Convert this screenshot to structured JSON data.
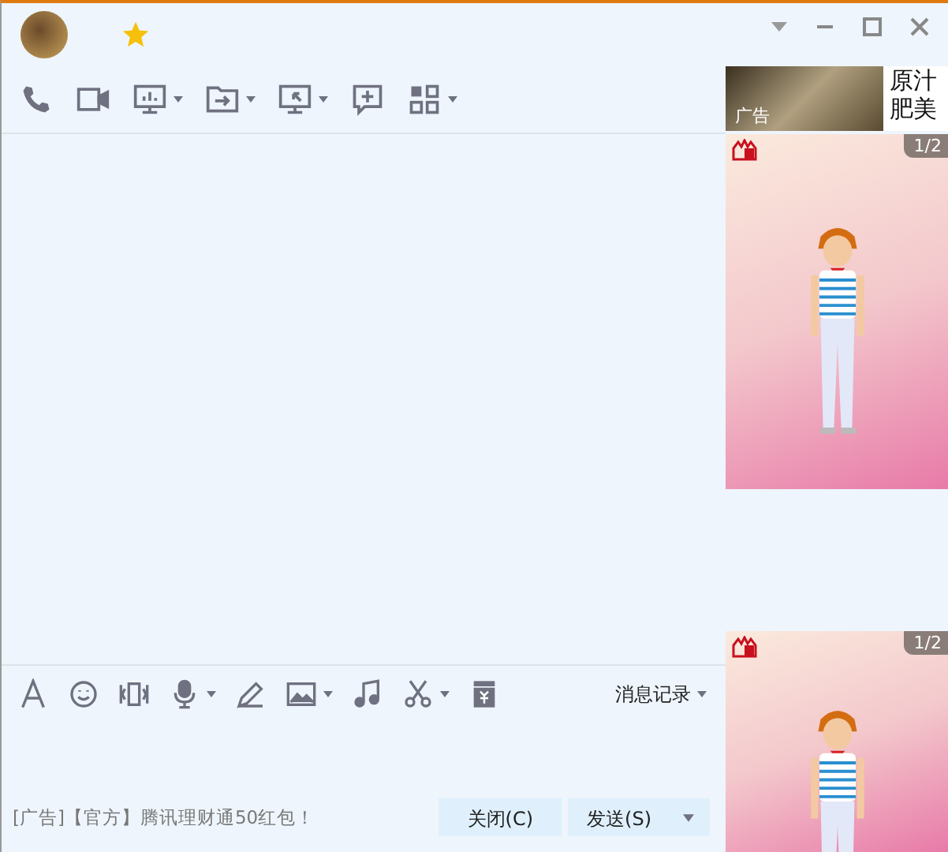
{
  "top_tools": [
    {
      "kind": "phone",
      "dropdown": false
    },
    {
      "kind": "video",
      "dropdown": false
    },
    {
      "kind": "screen-chart",
      "dropdown": true
    },
    {
      "kind": "folder-arrow",
      "dropdown": true
    },
    {
      "kind": "screen-arrow",
      "dropdown": true
    },
    {
      "kind": "chat-plus",
      "dropdown": false
    },
    {
      "kind": "apps",
      "dropdown": true
    }
  ],
  "input_tools": [
    {
      "kind": "font",
      "dropdown": false
    },
    {
      "kind": "smiley",
      "dropdown": false
    },
    {
      "kind": "shake",
      "dropdown": false
    },
    {
      "kind": "mic",
      "dropdown": true
    },
    {
      "kind": "pen",
      "dropdown": false
    },
    {
      "kind": "image",
      "dropdown": true
    },
    {
      "kind": "music",
      "dropdown": false
    },
    {
      "kind": "scissors",
      "dropdown": true
    },
    {
      "kind": "envelope",
      "dropdown": false
    }
  ],
  "history_button": "消息记录",
  "footer_ad": "[广告]【官方】腾讯理财通50红包！",
  "buttons": [
    {
      "label": "关闭(C)",
      "dropdown": false
    },
    {
      "label": "发送(S)",
      "dropdown": true
    }
  ],
  "side_ad": {
    "label": "广告",
    "lines": [
      "原汁",
      "肥美"
    ]
  },
  "show_panels": [
    {
      "page": "1/2"
    },
    {
      "page": "1/2"
    }
  ]
}
